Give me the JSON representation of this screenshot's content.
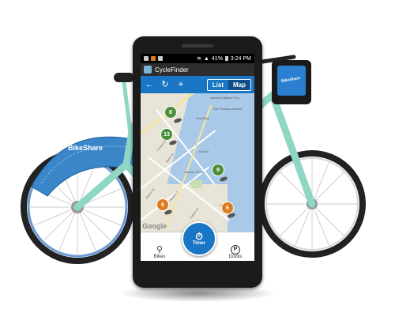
{
  "statusbar": {
    "battery": "41%",
    "time": "3:24 PM"
  },
  "app": {
    "title": "CycleFinder"
  },
  "toolbar": {
    "back_icon": "←",
    "refresh_icon": "↻",
    "locate_icon": "⌖",
    "list_label": "List",
    "map_label": "Map",
    "active_view": "Map"
  },
  "bike": {
    "brand_label": "BikeShare",
    "display_label": "BikeShare"
  },
  "map": {
    "attribution": "Google",
    "labels": [
      "Alameda-Oakland Ferry",
      "San Francisco-Oakland",
      "Ferry Bldg",
      "Beacon Place",
      "Main St",
      "Spear St",
      "Mission St",
      "Howard St",
      "Folsom St",
      "Fremont St",
      "Harrison St"
    ],
    "pins": [
      {
        "count": "8",
        "color": "#4a8f3a"
      },
      {
        "count": "13",
        "color": "#4a8f3a"
      },
      {
        "count": "9",
        "color": "#4a8f3a"
      },
      {
        "count": "6",
        "color": "#e07a1e"
      },
      {
        "count": "6",
        "color": "#e07a1e"
      }
    ]
  },
  "nav": {
    "bikes_label": "Bikes",
    "timer_label": "Timer",
    "docks_label": "Docks",
    "docks_icon": "P"
  }
}
